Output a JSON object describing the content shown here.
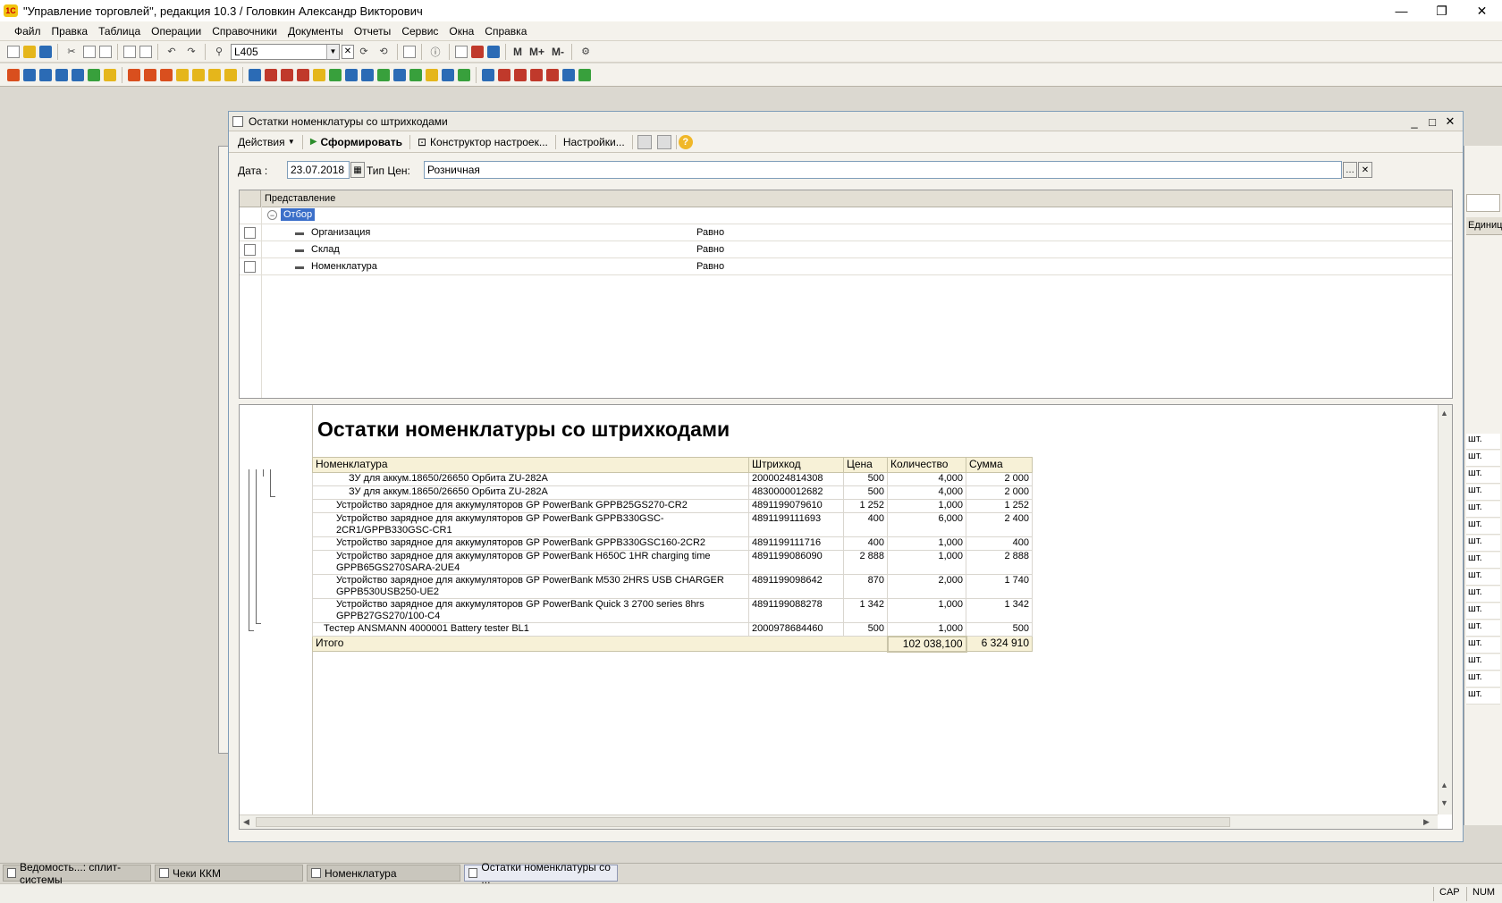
{
  "app": {
    "title": "\"Управление торговлей\", редакция 10.3 / Головкин Александр Викторович",
    "logo_text": "1С",
    "controls": [
      "—",
      "❐",
      "✕"
    ]
  },
  "menu": [
    {
      "label": "Файл"
    },
    {
      "label": "Правка"
    },
    {
      "label": "Таблица"
    },
    {
      "label": "Операции"
    },
    {
      "label": "Справочники"
    },
    {
      "label": "Документы"
    },
    {
      "label": "Отчеты"
    },
    {
      "label": "Сервис"
    },
    {
      "label": "Окна"
    },
    {
      "label": "Справка"
    }
  ],
  "toolbar1": {
    "search_value": "L405",
    "buttons_text": [
      "M",
      "M+",
      "M-"
    ]
  },
  "report_window": {
    "title": "Остатки номенклатуры со штрихкодами",
    "controls": [
      "_",
      "□",
      "✕"
    ],
    "commands": {
      "actions": "Действия",
      "generate": "Сформировать",
      "constructor": "Конструктор настроек...",
      "settings": "Настройки..."
    },
    "params": {
      "date_label": "Дата :",
      "date_value": "23.07.2018",
      "price_type_label": "Тип Цен:",
      "price_type_value": "Розничная"
    },
    "settings_table": {
      "header": "Представление",
      "group_label": "Отбор",
      "rows": [
        {
          "name": "Организация",
          "condition": "Равно"
        },
        {
          "name": "Склад",
          "condition": "Равно"
        },
        {
          "name": "Номенклатура",
          "condition": "Равно"
        }
      ]
    },
    "report": {
      "title": "Остатки номенклатуры со штрихкодами",
      "columns": [
        "Номенклатура",
        "Штрихкод",
        "Цена",
        "Количество",
        "Сумма"
      ],
      "rows": [
        {
          "name": "ЗУ для аккум.18650/26650 Орбита ZU-282A",
          "barcode": "2000024814308",
          "price": "500",
          "qty": "4,000",
          "sum": "2 000",
          "indent": 3
        },
        {
          "name": "ЗУ для аккум.18650/26650 Орбита ZU-282A",
          "barcode": "4830000012682",
          "price": "500",
          "qty": "4,000",
          "sum": "2 000",
          "indent": 3
        },
        {
          "name": "Устройство зарядное для аккумуляторов GP PowerBank GPPB25GS270-CR2",
          "barcode": "4891199079610",
          "price": "1 252",
          "qty": "1,000",
          "sum": "1 252",
          "indent": 2
        },
        {
          "name": "Устройство зарядное для аккумуляторов GP PowerBank GPPB330GSC-2CR1/GPPB330GSC-CR1",
          "barcode": "4891199111693",
          "price": "400",
          "qty": "6,000",
          "sum": "2 400",
          "indent": 2
        },
        {
          "name": "Устройство зарядное для аккумуляторов GP PowerBank GPPB330GSC160-2CR2",
          "barcode": "4891199111716",
          "price": "400",
          "qty": "1,000",
          "sum": "400",
          "indent": 2
        },
        {
          "name": "Устройство зарядное для аккумуляторов GP PowerBank H650C 1HR charging time GPPB65GS270SARA-2UE4",
          "barcode": "4891199086090",
          "price": "2 888",
          "qty": "1,000",
          "sum": "2 888",
          "indent": 2
        },
        {
          "name": "Устройство зарядное для аккумуляторов GP PowerBank M530 2HRS USB CHARGER GPPB530USB250-UE2",
          "barcode": "4891199098642",
          "price": "870",
          "qty": "2,000",
          "sum": "1 740",
          "indent": 2
        },
        {
          "name": "Устройство зарядное для аккумуляторов GP PowerBank Quick 3 2700 series 8hrs GPPB27GS270/100-C4",
          "barcode": "4891199088278",
          "price": "1 342",
          "qty": "1,000",
          "sum": "1 342",
          "indent": 2
        },
        {
          "name": "Тестер ANSMANN 4000001 Battery tester BL1",
          "barcode": "2000978684460",
          "price": "500",
          "qty": "1,000",
          "sum": "500",
          "indent": 1
        }
      ],
      "total": {
        "label": "Итого",
        "qty": "102 038,100",
        "sum": "6 324 910"
      }
    }
  },
  "background_window": {
    "header_fragment": "Единиц",
    "unit_cells": [
      "шт.",
      "шт.",
      "шт.",
      "шт.",
      "шт.",
      "шт.",
      "шт.",
      "шт.",
      "шт.",
      "шт.",
      "шт.",
      "шт.",
      "шт.",
      "шт.",
      "шт.",
      "шт."
    ]
  },
  "taskbar": [
    {
      "label": "Ведомость...: сплит-системы",
      "active": false
    },
    {
      "label": "Чеки ККМ",
      "active": false
    },
    {
      "label": "Номенклатура",
      "active": false
    },
    {
      "label": "Остатки номенклатуры со ...",
      "active": true
    }
  ],
  "statusbar": {
    "cap": "CAP",
    "num": "NUM"
  }
}
